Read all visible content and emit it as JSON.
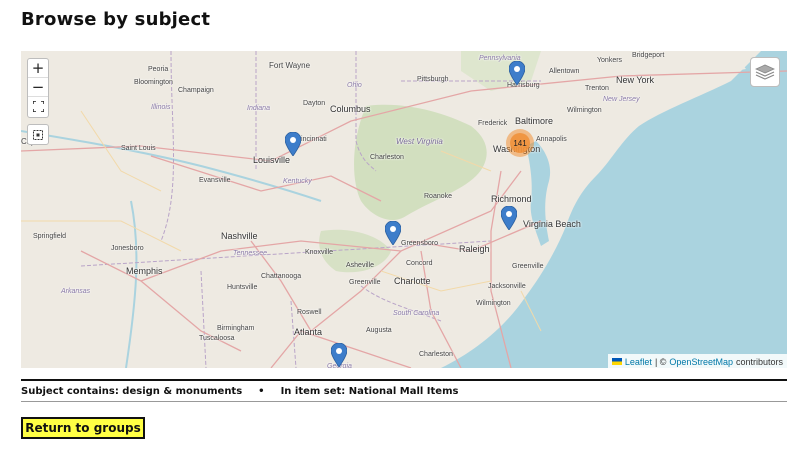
{
  "page": {
    "title": "Browse by subject"
  },
  "map": {
    "zoom_in": "+",
    "zoom_out": "−",
    "cluster_count": "141",
    "city_labels": {
      "fort_wayne": "Fort Wayne",
      "peoria": "Peoria",
      "bloomington": "Bloomington",
      "champaign": "Champaign",
      "illinois": "Illinois",
      "indiana": "Indiana",
      "dayton": "Dayton",
      "columbus": "Columbus",
      "ohio": "Ohio",
      "pittsburgh": "Pittsburgh",
      "pennsylvania": "Pennsylvania",
      "harrisburg": "Harrisburg",
      "allentown": "Allentown",
      "bridgeport": "Bridgeport",
      "yonkers": "Yonkers",
      "new_york": "New York",
      "trenton": "Trenton",
      "new_jersey": "New Jersey",
      "wilmington_de": "Wilmington",
      "baltimore": "Baltimore",
      "frederick": "Frederick",
      "annapolis": "Annapolis",
      "washington": "Washington",
      "west_virginia": "West Virginia",
      "charleston_wv": "Charleston",
      "cincinnati": "Cincinnati",
      "louisville": "Louisville",
      "kentucky": "Kentucky",
      "saint_louis": "Saint Louis",
      "springfield": "Springfield",
      "evansville": "Evansville",
      "city_left": "City",
      "roanoke": "Roanoke",
      "richmond": "Richmond",
      "virginia_beach": "Virginia Beach",
      "nashville": "Nashville",
      "tennessee": "Tennessee",
      "knoxville": "Knoxville",
      "greensboro": "Greensboro",
      "raleigh": "Raleigh",
      "jonesboro": "Jonesboro",
      "memphis": "Memphis",
      "asheville": "Asheville",
      "concord": "Concord",
      "greenville_nc": "Greenville",
      "charlotte": "Charlotte",
      "chattanooga": "Chattanooga",
      "arkansas": "Arkansas",
      "huntsville": "Huntsville",
      "greenville_sc": "Greenville",
      "jacksonville": "Jacksonville",
      "wilmington_nc": "Wilmington",
      "roswell": "Roswell",
      "atlanta": "Atlanta",
      "birmingham": "Birmingham",
      "south_carolina": "South Carolina",
      "augusta": "Augusta",
      "tuscaloosa": "Tuscaloosa",
      "georgia": "Georgia",
      "charleston_sc": "Charleston"
    },
    "attribution": {
      "leaflet": "Leaflet",
      "separator": "| ©",
      "osm": "OpenStreetMap",
      "suffix": "contributors"
    }
  },
  "filters": {
    "subject": "Subject contains: design & monuments",
    "bullet": "•",
    "item_set": "In item set: National Mall Items"
  },
  "return_button": "Return to groups",
  "colors": {
    "marker": "#3d7dca",
    "cluster": "#f0923c",
    "water": "#aad3df",
    "button": "#ffff44"
  }
}
